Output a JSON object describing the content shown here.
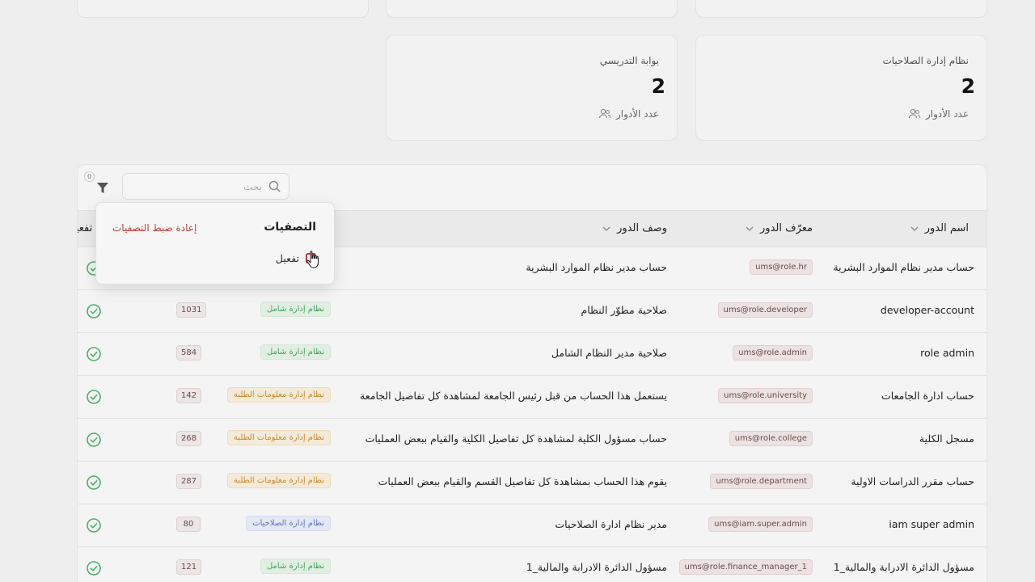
{
  "top_cards": [
    {},
    {},
    {}
  ],
  "stat_cards": [
    {
      "title": "نظام إدارة الصلاحيات",
      "value": "2",
      "footer": "عدد الأدوار"
    },
    {
      "title": "بوابة التدريسي",
      "value": "2",
      "footer": "عدد الأدوار"
    }
  ],
  "toolbar": {
    "search_placeholder": "بحث",
    "filter_count": "0"
  },
  "table": {
    "headers": {
      "name": "اسم الدور",
      "code": "معرّف الدور",
      "desc": "وصف الدور",
      "active_partial": "تفعيل"
    },
    "rows": [
      {
        "name": "حساب مدير نظام الموارد البشرية",
        "code": "ums@role.hr",
        "desc": "حساب مدير نظام الموارد البشرية",
        "system": "",
        "count": "",
        "active": true
      },
      {
        "name": "developer-account",
        "code": "ums@role.developer",
        "desc": "صلاحية مطوّر النظام",
        "system": "نظام إدارة شامل",
        "system_color": "green",
        "count": "1031",
        "active": true
      },
      {
        "name": "role admin",
        "code": "ums@role.admin",
        "desc": "صلاحية مدير النظام الشامل",
        "system": "نظام إدارة شامل",
        "system_color": "green",
        "count": "584",
        "active": true
      },
      {
        "name": "حساب ادارة الجامعات",
        "code": "ums@role.university",
        "desc": "يستعمل هذا الحساب من قبل رئيس الجامعة لمشاهدة كل تفاصيل الجامعة",
        "system": "نظام إدارة معلومات الطلبة",
        "system_color": "orange",
        "count": "142",
        "active": true
      },
      {
        "name": "مسجل الكلية",
        "code": "ums@role.college",
        "desc": "حساب مسؤول الكلية لمشاهدة كل تفاصيل الكلية والقيام ببعض العمليات",
        "system": "نظام إدارة معلومات الطلبة",
        "system_color": "orange",
        "count": "268",
        "active": true
      },
      {
        "name": "حساب مقرر الدراسات الاولية",
        "code": "ums@role.department",
        "desc": "يقوم هذا الحساب بمشاهدة كل تفاصيل القسم والقيام ببعض العمليات",
        "system": "نظام إدارة معلومات الطلبة",
        "system_color": "orange",
        "count": "287",
        "active": true
      },
      {
        "name": "iam super admin",
        "code": "ums@iam.super.admin",
        "desc": "مدير نظام ادارة الصلاحيات",
        "system": "نظام إدارة الصلاحيات",
        "system_color": "blue",
        "count": "80",
        "active": true
      },
      {
        "name": "مسؤول الدائرة الادرابة والمالية_1",
        "code": "ums@role.finance_manager_1",
        "desc": "مسؤول الدائرة الادرابة والمالية_1",
        "system": "نظام إدارة شامل",
        "system_color": "green",
        "count": "121",
        "active": true
      }
    ]
  },
  "filter_popup": {
    "title": "التصفيات",
    "reset_label": "إعادة ضبط التصفيات",
    "option_label": "تفعيل"
  },
  "colors": {
    "accent_red": "#c23b3b",
    "active_green": "#4caf6a"
  }
}
